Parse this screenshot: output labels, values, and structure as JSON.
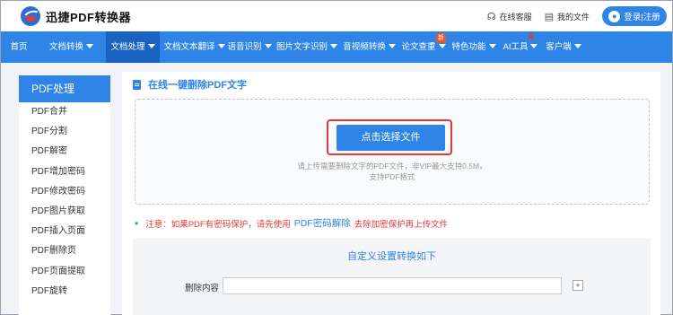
{
  "header": {
    "brand": "迅捷PDF转换器",
    "support": "在线客服",
    "my_files": "我的文件",
    "login": "登录|注册"
  },
  "nav": {
    "items": [
      {
        "label": "首页",
        "caret": false
      },
      {
        "label": "文档转换",
        "caret": true
      },
      {
        "label": "文档处理",
        "caret": true,
        "active": true
      },
      {
        "label": "文档文本翻译",
        "caret": true
      },
      {
        "label": "语音识别",
        "caret": true
      },
      {
        "label": "图片文字识别",
        "caret": true
      },
      {
        "label": "音视频转换",
        "caret": true
      },
      {
        "label": "论文查重",
        "caret": true
      },
      {
        "label": "特色功能",
        "caret": true
      },
      {
        "label": "AI工具",
        "caret": true
      },
      {
        "label": "客户端",
        "caret": true
      }
    ],
    "new_badge": "新"
  },
  "sidebar": {
    "title": "PDF处理",
    "items": [
      "PDF合并",
      "PDF分割",
      "PDF解密",
      "PDF增加密码",
      "PDF修改密码",
      "PDF图片获取",
      "PDF插入页面",
      "PDF删除页",
      "PDF页面提取",
      "PDF旋转"
    ]
  },
  "main": {
    "title": "在线一键删除PDF文字",
    "select_button": "点击选择文件",
    "hint_line1": "请上传需要删除文字的PDF文件，非VIP最大支持0.5M，",
    "hint_line2": "支持PDF格式",
    "notice_prefix": "注意：如果PDF有密码保护，请先使用",
    "notice_link": "PDF密码解除",
    "notice_suffix": "去除加密保护再上传文件",
    "settings_title": "自定义设置转换如下",
    "delete_label": "删除内容",
    "delete_value": "",
    "plus": "+"
  },
  "colors": {
    "accent": "#2f84e8",
    "nav_active": "#1a63c2",
    "warning": "#e53935"
  }
}
